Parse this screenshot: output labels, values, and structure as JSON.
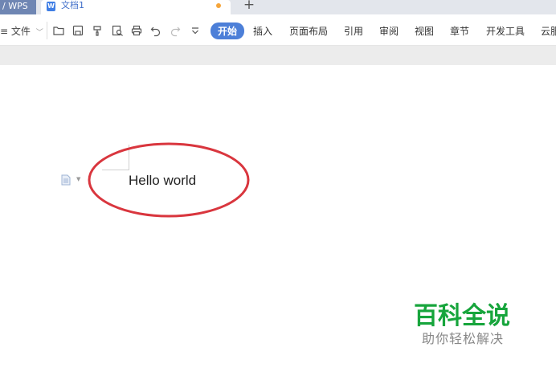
{
  "tabs": {
    "app_label": "WPS",
    "app_prefix": "/",
    "doc_icon_glyph": "W",
    "doc_title": "文档1",
    "unsaved_dot_color": "#f5a53a",
    "add_tab_label": "+"
  },
  "toolbar": {
    "file_menu_prefix": "≡",
    "file_menu_label": "文件",
    "quick_access_icons": [
      "open-folder-icon",
      "save-icon",
      "format-painter-icon",
      "print-preview-icon",
      "print-icon",
      "undo-icon",
      "redo-icon",
      "customize-dropdown-icon"
    ],
    "ribbon_tabs": [
      "开始",
      "插入",
      "页面布局",
      "引用",
      "审阅",
      "视图",
      "章节",
      "开发工具",
      "云服务"
    ],
    "active_tab": "开始",
    "accent_color": "#4c7fd8"
  },
  "document": {
    "text": "Hello world",
    "annotation_color": "#d9363e"
  },
  "watermark": {
    "title": "百科全说",
    "subtitle": "助你轻松解决",
    "title_color": "#17a53c"
  }
}
